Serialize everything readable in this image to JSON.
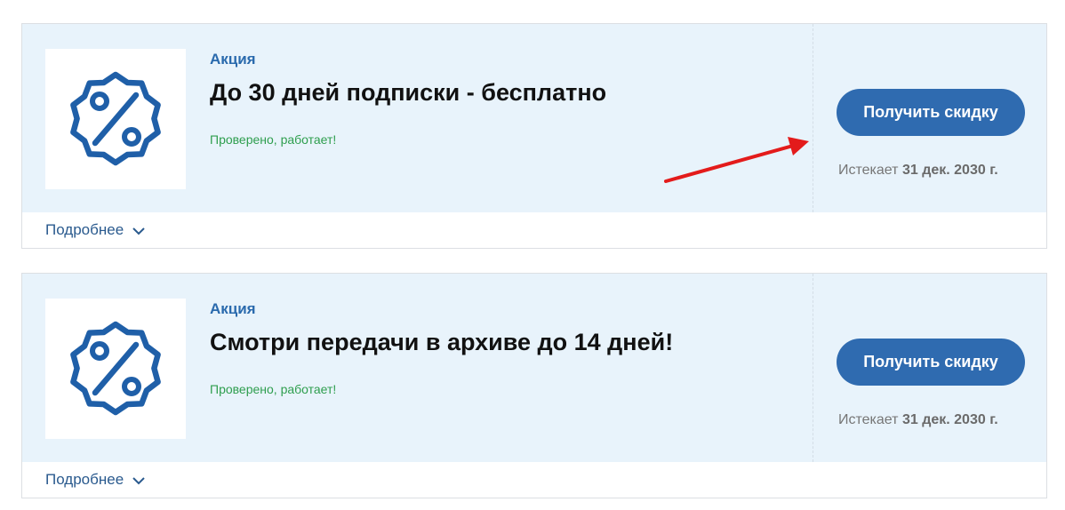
{
  "promos": [
    {
      "tag": "Акция",
      "title": "До 30 дней подписки - бесплатно",
      "verified": "Проверено, работает!",
      "button_label": "Получить скидку",
      "expires_prefix": "Истекает",
      "expires_date": "31 дек. 2030 г.",
      "details_label": "Подробнее",
      "icon": "percent-badge-icon"
    },
    {
      "tag": "Акция",
      "title": "Смотри передачи в архиве до 14 дней!",
      "verified": "Проверено, работает!",
      "button_label": "Получить скидку",
      "expires_prefix": "Истекает",
      "expires_date": "31 дек. 2030 г.",
      "details_label": "Подробнее",
      "icon": "percent-badge-icon"
    }
  ],
  "colors": {
    "accent": "#2f6bb0",
    "card_bg": "#e8f3fb",
    "verified": "#2e9e4e",
    "annotation_arrow": "#e31b1b"
  }
}
